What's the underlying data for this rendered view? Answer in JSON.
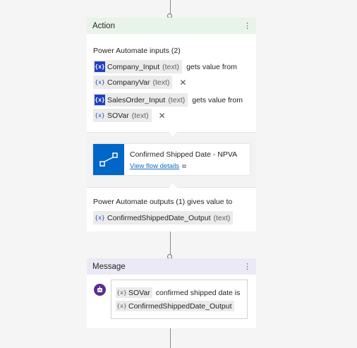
{
  "action_card": {
    "title": "Action",
    "inputs_heading": "Power Automate inputs (2)",
    "inputs": [
      {
        "name": "Company_Input",
        "type": "(text)",
        "connector": "gets value from",
        "value_name": "CompanyVar",
        "value_type": "(text)",
        "var_icon": "{x}",
        "clear_icon": "✕"
      },
      {
        "name": "SalesOrder_Input",
        "type": "(text)",
        "connector": "gets value from",
        "value_name": "SOVar",
        "value_type": "(text)",
        "var_icon": "{x}",
        "clear_icon": "✕"
      }
    ],
    "flow": {
      "name": "Confirmed Shipped Date - NPVA",
      "link_label": "View flow details",
      "icon": "flow-icon"
    },
    "outputs_heading": "Power Automate outputs (1) gives value to",
    "output": {
      "name": "ConfirmedShippedDate_Output",
      "type": "(text)",
      "var_icon": "{x}"
    }
  },
  "message_card": {
    "title": "Message",
    "avatar_icon": "bot-icon",
    "line1_var": "SOVar",
    "line1_text": "confirmed shipped date is",
    "line2_var": "ConfirmedShippedDate_Output",
    "var_icon": "{x}"
  },
  "colors": {
    "action_header": "#e8f4e8",
    "message_header": "#ebe9f5",
    "variable_blue": "#1f3fc1",
    "flow_blue": "#0066c7",
    "bot_purple": "#5b2d91"
  }
}
